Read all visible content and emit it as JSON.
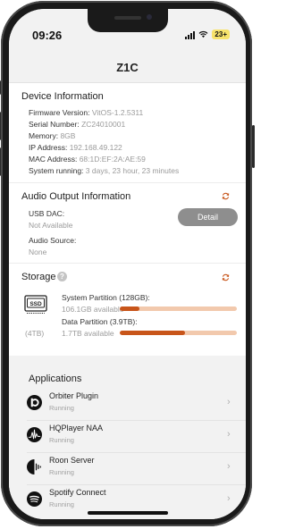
{
  "status_bar": {
    "time": "09:26",
    "battery": "23+"
  },
  "app_title": "Z1C",
  "device_info": {
    "title": "Device Information",
    "rows": [
      {
        "label": "Firmware Version:",
        "value": "VitOS-1.2.5311"
      },
      {
        "label": "Serial Number:",
        "value": "ZC24010001"
      },
      {
        "label": "Memory:",
        "value": "8GB"
      },
      {
        "label": "IP Address:",
        "value": "192.168.49.122"
      },
      {
        "label": "MAC Address:",
        "value": "68:1D:EF:2A:AE:59"
      },
      {
        "label": "System running:",
        "value": "3 days, 23 hour, 23 minutes"
      }
    ]
  },
  "audio_output": {
    "title": "Audio Output Information",
    "usb_dac_label": "USB DAC:",
    "usb_dac_value": "Not Available",
    "detail_button": "Detail",
    "audio_source_label": "Audio Source:",
    "audio_source_value": "None"
  },
  "storage": {
    "title": "Storage",
    "help": "?",
    "ssd_label": "SSD",
    "ssd_size": "(4TB)",
    "partitions": [
      {
        "name": "System Partition (128GB):",
        "available": "106.1GB available",
        "used_fraction": 0.17
      },
      {
        "name": "Data Partition (3.9TB):",
        "available": "1.7TB available",
        "used_fraction": 0.56
      }
    ]
  },
  "applications": {
    "title": "Applications",
    "items": [
      {
        "name": "Orbiter Plugin",
        "status": "Running",
        "icon": "orbiter-icon"
      },
      {
        "name": "HQPlayer NAA",
        "status": "Running",
        "icon": "hqplayer-icon"
      },
      {
        "name": "Roon Server",
        "status": "Running",
        "icon": "roon-icon"
      },
      {
        "name": "Spotify Connect",
        "status": "Running",
        "icon": "spotify-icon"
      }
    ]
  },
  "colors": {
    "accent": "#c8551a",
    "bar_bg": "#f2c9ad",
    "detail_button": "#8e8e8e"
  }
}
